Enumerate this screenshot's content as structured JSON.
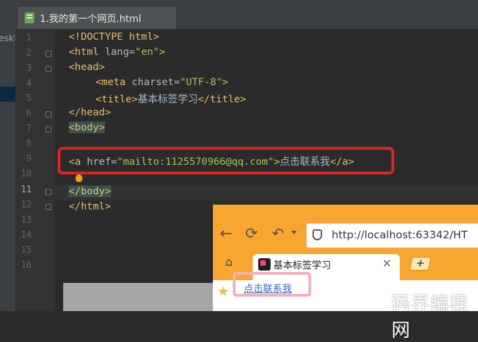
{
  "editor": {
    "tab_filename": "1.我的第一个网页.html",
    "project_panel_fragment": "eskt",
    "line_numbers": [
      "1",
      "2",
      "3",
      "4",
      "5",
      "6",
      "7",
      "8",
      "9",
      "10",
      "11",
      "12",
      "13",
      "14",
      "15",
      "16"
    ],
    "current_line": "11",
    "code": {
      "l1": "<!DOCTYPE html>",
      "l2_tag_open": "<html ",
      "l2_attr": "lang=",
      "l2_val": "\"en\"",
      "l2_close": ">",
      "l3": "<head>",
      "l4_tag_open": "<meta ",
      "l4_attr": "charset=",
      "l4_val": "\"UTF-8\"",
      "l4_close": ">",
      "l5_open": "<title>",
      "l5_text": "基本标签学习",
      "l5_close": "</title>",
      "l6": "</head>",
      "l7": "<body>",
      "l9_tag_open": "<a ",
      "l9_attr": "href=",
      "l9_val": "\"mailto:1125570966@qq.com\"",
      "l9_close": ">",
      "l9_text": "点击联系我",
      "l9_end": "</a>",
      "l11": "</body>",
      "l12": "</html>"
    }
  },
  "browser": {
    "url": "http://localhost:63342/HT",
    "tab_title": "基本标签学习",
    "tab_close": "✕",
    "new_tab": "+",
    "link_text": "点击联系我",
    "icons": {
      "back": "←",
      "refresh": "⟳",
      "undo": "↶",
      "home": "⌂",
      "bookmark": "★"
    }
  },
  "watermark": "码界编程网",
  "colors": {
    "editor_bg": "#2b2b2b",
    "tag": "#e8bf6a",
    "string": "#a5c25c",
    "highlight_box": "#e0231c",
    "browser_frame": "#f9a630",
    "link": "#3a64c4"
  }
}
